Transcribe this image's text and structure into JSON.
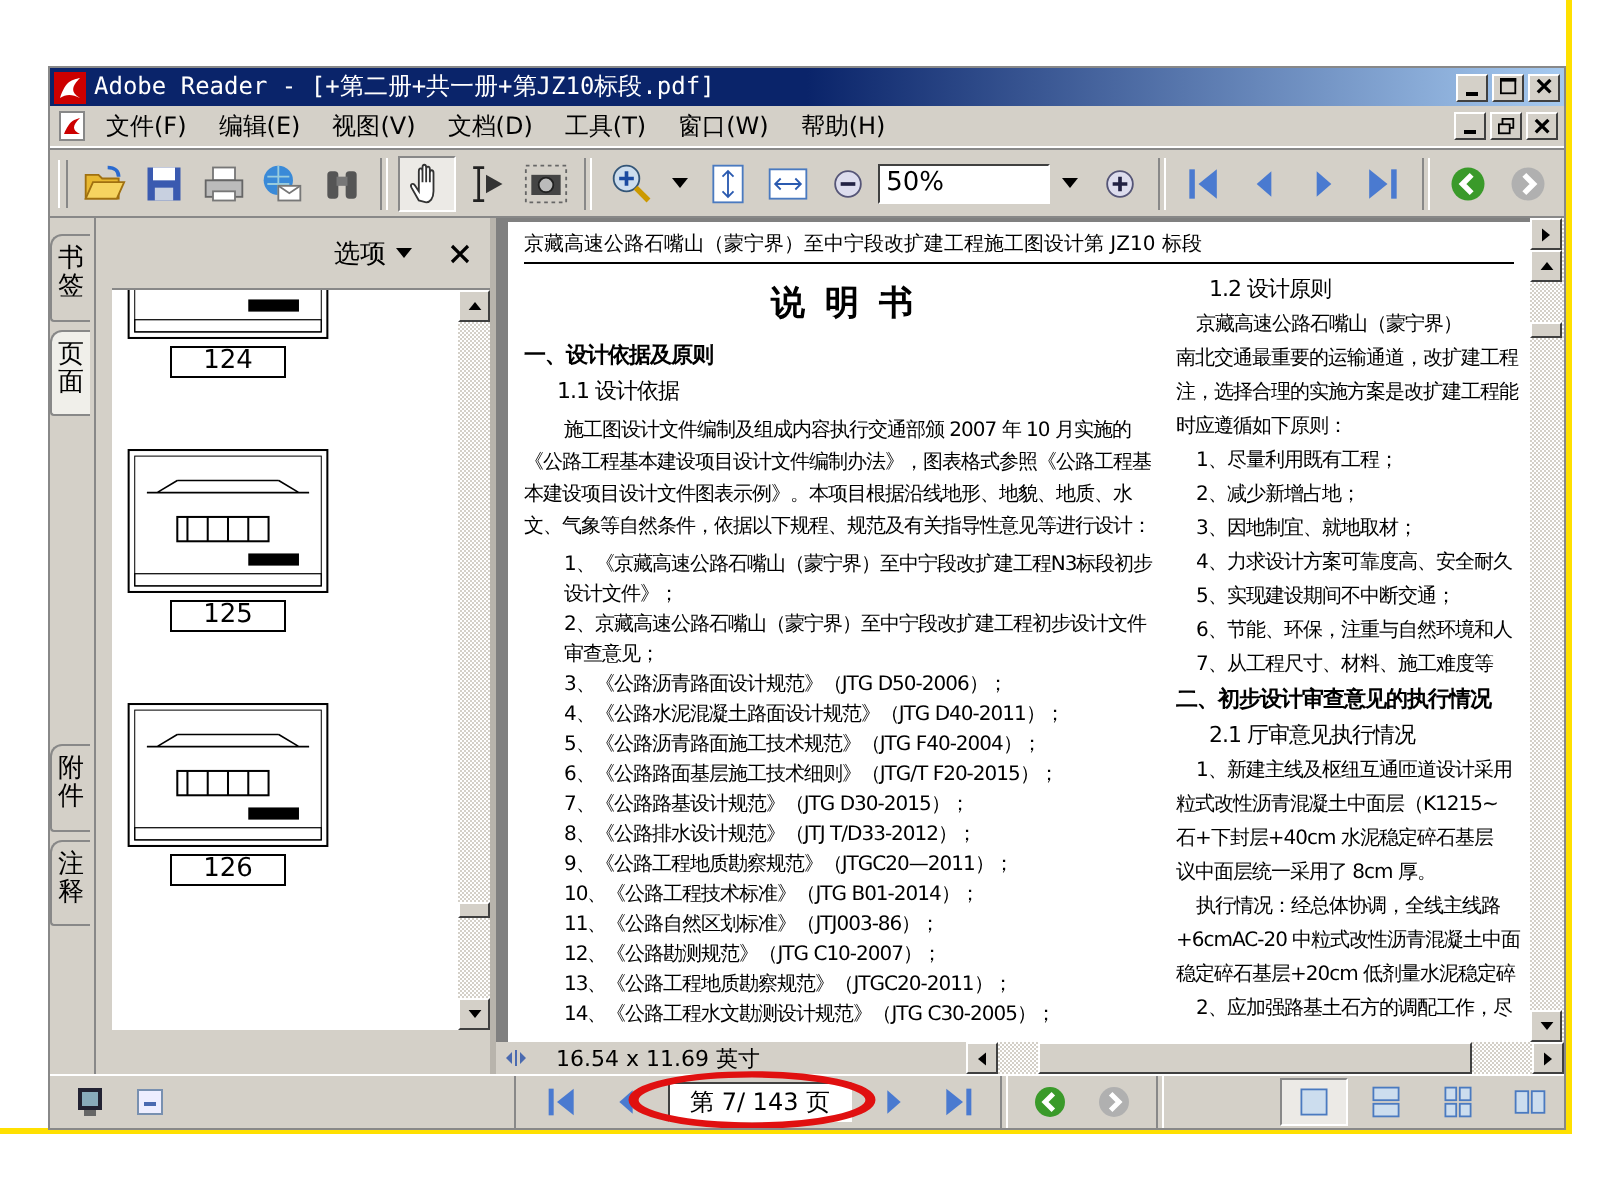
{
  "window": {
    "title": "Adobe Reader - [+第二册+共一册+第JZ10标段.pdf]"
  },
  "menu": [
    {
      "label": "文件(F)"
    },
    {
      "label": "编辑(E)"
    },
    {
      "label": "视图(V)"
    },
    {
      "label": "文档(D)"
    },
    {
      "label": "工具(T)"
    },
    {
      "label": "窗口(W)"
    },
    {
      "label": "帮助(H)"
    }
  ],
  "toolbar": {
    "tools": [
      {
        "kind": "hand",
        "selected": true
      },
      {
        "kind": "select",
        "selected": false
      },
      {
        "kind": "snapshot",
        "selected": false
      }
    ],
    "zoom": "50%",
    "history": [
      {
        "kind": "back",
        "disabled": false
      },
      {
        "kind": "forward",
        "disabled": true
      }
    ]
  },
  "sidebar": {
    "tabs": [
      {
        "label": "书签",
        "selected": false
      },
      {
        "label": "页面",
        "selected": true
      },
      {
        "label": "附件",
        "selected": false
      },
      {
        "label": "注释",
        "selected": false
      }
    ],
    "options": "选项",
    "thumbnails": [
      {
        "page": "124"
      },
      {
        "page": "125"
      },
      {
        "page": "126"
      }
    ]
  },
  "document": {
    "header": "京藏高速公路石嘴山（蒙宁界）至中宁段改扩建工程施工图设计第 JZ10 标段",
    "title": "说 明 书",
    "left": [
      {
        "kind": "heading",
        "text": "一、设计依据及原则"
      },
      {
        "kind": "subheading",
        "text": "1.1 设计依据"
      },
      {
        "kind": "para",
        "text": "施工图设计文件编制及组成内容执行交通部颁 2007 年 10 月实施的《公路工程基本建设项目设计文件编制办法》，图表格式参照《公路工程基本建设项目设计文件图表示例》。本项目根据沿线地形、地貌、地质、水文、气象等自然条件，依据以下规程、规范及有关指导性意见等进行设计："
      },
      {
        "kind": "item",
        "text": "1、《京藏高速公路石嘴山（蒙宁界）至中宁段改扩建工程N3标段初步设计文件》；"
      },
      {
        "kind": "item",
        "text": "2、京藏高速公路石嘴山（蒙宁界）至中宁段改扩建工程初步设计文件审查意见；"
      },
      {
        "kind": "item",
        "text": "3、《公路沥青路面设计规范》（JTG D50-2006）；"
      },
      {
        "kind": "item",
        "text": "4、《公路水泥混凝土路面设计规范》（JTG D40-2011）；"
      },
      {
        "kind": "item",
        "text": "5、《公路沥青路面施工技术规范》（JTG F40-2004）；"
      },
      {
        "kind": "item",
        "text": "6、《公路路面基层施工技术细则》（JTG/T F20-2015）；"
      },
      {
        "kind": "item",
        "text": "7、《公路路基设计规范》（JTG D30-2015）；"
      },
      {
        "kind": "item",
        "text": "8、《公路排水设计规范》（JTJ T/D33-2012）；"
      },
      {
        "kind": "item",
        "text": "9、《公路工程地质勘察规范》（JTGC20—2011）；"
      },
      {
        "kind": "item",
        "text": "10、《公路工程技术标准》（JTG B01-2014）；"
      },
      {
        "kind": "item",
        "text": "11、《公路自然区划标准》（JTJ003-86）；"
      },
      {
        "kind": "item",
        "text": "12、《公路勘测规范》（JTG C10-2007）；"
      },
      {
        "kind": "item",
        "text": "13、《公路工程地质勘察规范》（JTGC20-2011）；"
      },
      {
        "kind": "item",
        "text": "14、《公路工程水文勘测设计规范》（JTG C30-2005）；"
      }
    ],
    "right": [
      {
        "kind": "subheading",
        "text": "1.2 设计原则"
      },
      {
        "kind": "indent",
        "text": "京藏高速公路石嘴山（蒙宁界）"
      },
      {
        "kind": "line",
        "text": "南北交通最重要的运输通道，改扩建工程"
      },
      {
        "kind": "line",
        "text": "注，选择合理的实施方案是改扩建工程能"
      },
      {
        "kind": "line",
        "text": "时应遵循如下原则："
      },
      {
        "kind": "indent",
        "text": "1、尽量利用既有工程；"
      },
      {
        "kind": "indent",
        "text": "2、减少新增占地；"
      },
      {
        "kind": "indent",
        "text": "3、因地制宜、就地取材；"
      },
      {
        "kind": "indent",
        "text": "4、力求设计方案可靠度高、安全耐久"
      },
      {
        "kind": "indent",
        "text": "5、实现建设期间不中断交通；"
      },
      {
        "kind": "indent",
        "text": "6、节能、环保，注重与自然环境和人"
      },
      {
        "kind": "indent",
        "text": "7、从工程尺寸、材料、施工难度等"
      },
      {
        "kind": "heading",
        "text": "二、初步设计审查意见的执行情况"
      },
      {
        "kind": "subheading",
        "text": "2.1 厅审意见执行情况"
      },
      {
        "kind": "indent",
        "text": "1、新建主线及枢纽互通匝道设计采用"
      },
      {
        "kind": "line",
        "text": "粒式改性沥青混凝土中面层（K1215~"
      },
      {
        "kind": "line",
        "text": "石+下封层+40cm 水泥稳定碎石基层"
      },
      {
        "kind": "line",
        "text": "议中面层统一采用了 8cm 厚。"
      },
      {
        "kind": "indent",
        "text": "执行情况：经总体协调，全线主线路"
      },
      {
        "kind": "line",
        "text": "+6cmAC-20 中粒式改性沥青混凝土中面"
      },
      {
        "kind": "line",
        "text": "稳定碎石基层+20cm 低剂量水泥稳定碎"
      },
      {
        "kind": "indent",
        "text": "2、应加强路基土石方的调配工作，尽"
      }
    ],
    "page_size": "16.54 x 11.69 英寸"
  },
  "status": {
    "page": "第 7/ 143 页",
    "history": [
      {
        "kind": "back",
        "disabled": false
      },
      {
        "kind": "forward",
        "disabled": true
      }
    ],
    "view_modes": [
      {
        "kind": "single",
        "selected": true
      },
      {
        "kind": "continuous",
        "selected": false
      },
      {
        "kind": "continuous-facing",
        "selected": false
      },
      {
        "kind": "facing",
        "selected": false
      }
    ]
  }
}
